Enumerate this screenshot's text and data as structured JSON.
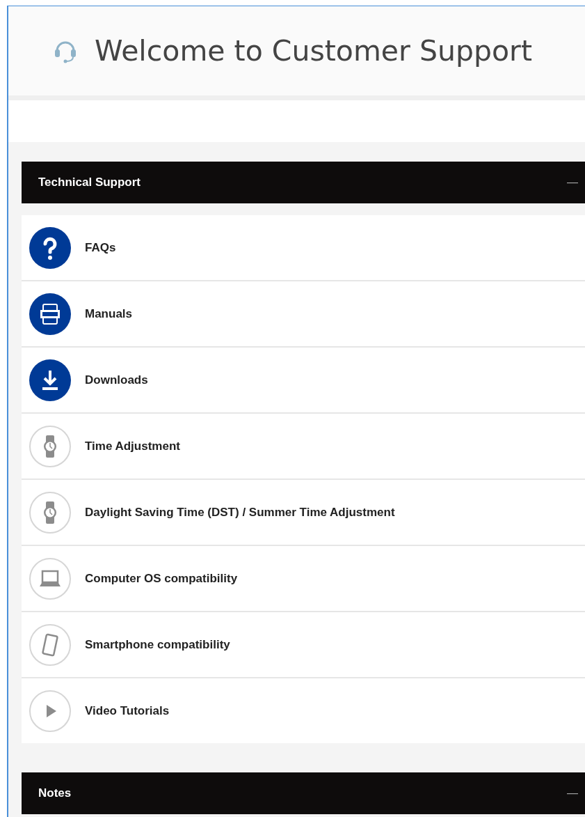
{
  "header": {
    "title": "Welcome to Customer Support"
  },
  "sections": [
    {
      "title": "Technical Support",
      "toggle": "—",
      "items": [
        {
          "label": "FAQs"
        },
        {
          "label": "Manuals"
        },
        {
          "label": "Downloads"
        },
        {
          "label": "Time Adjustment"
        },
        {
          "label": "Daylight Saving Time (DST) / Summer Time Adjustment"
        },
        {
          "label": "Computer OS compatibility"
        },
        {
          "label": "Smartphone compatibility"
        },
        {
          "label": "Video Tutorials"
        }
      ]
    },
    {
      "title": "Notes",
      "toggle": "—"
    }
  ]
}
